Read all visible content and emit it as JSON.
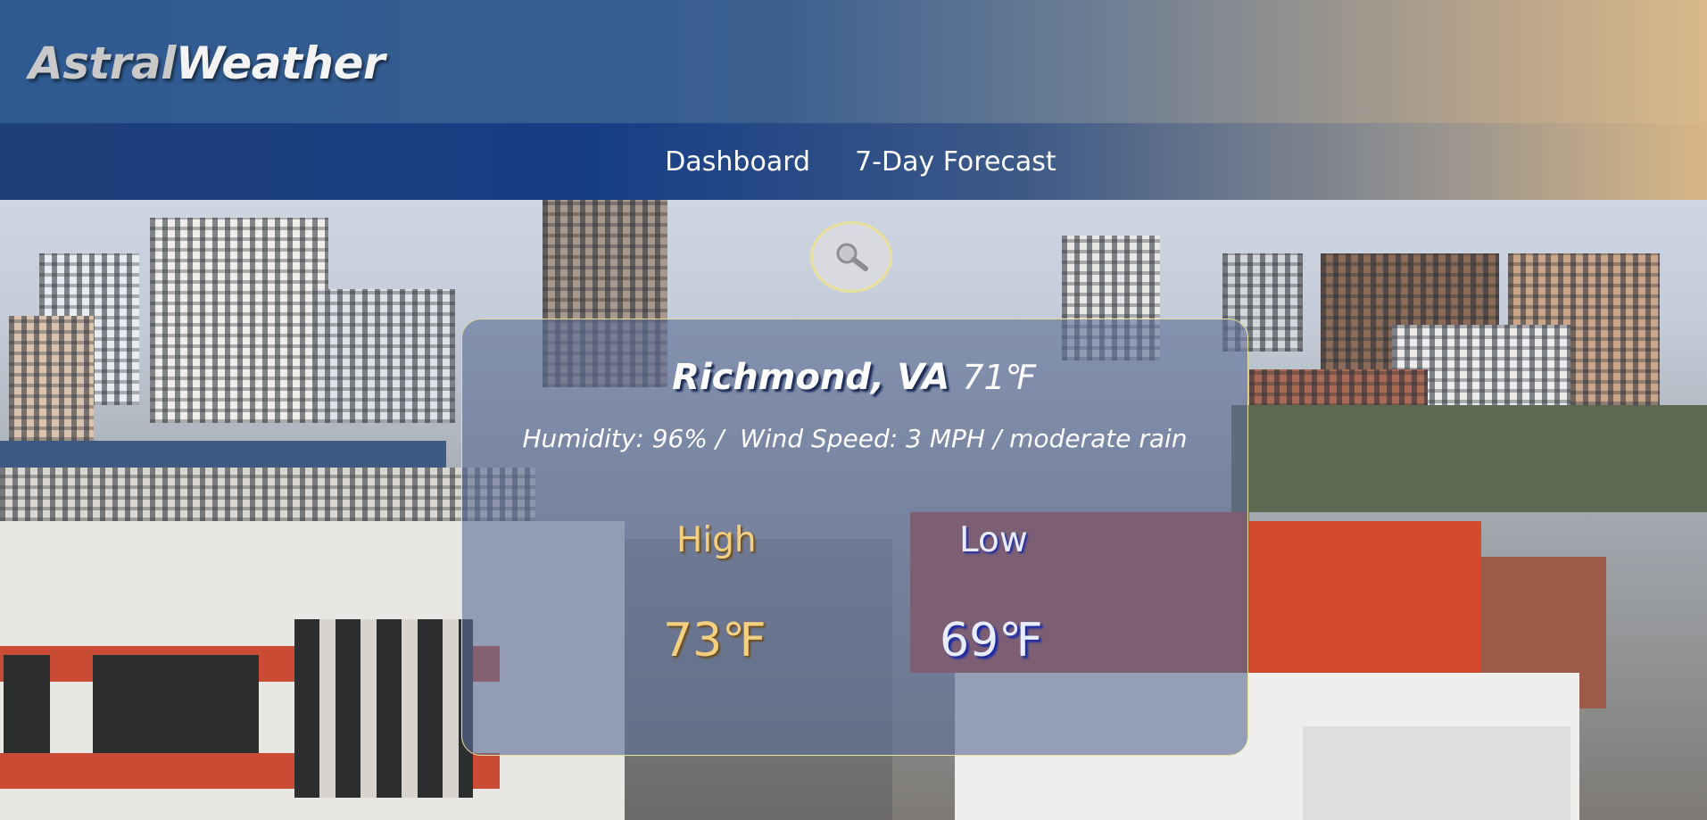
{
  "brand": {
    "part1": "Astral",
    "part2": "Weather"
  },
  "nav": {
    "items": [
      "Dashboard",
      "7-Day Forecast"
    ]
  },
  "search": {
    "icon": "search-icon"
  },
  "weather": {
    "city": "Richmond, VA",
    "current_temp": "71℉",
    "details": "Humidity: 96% /  Wind Speed: 3 MPH / moderate rain",
    "high_label": "High",
    "high_value": "73℉",
    "low_label": "Low",
    "low_value": "69℉"
  },
  "colors": {
    "header_start": "#2e5a92",
    "header_end": "#d9b98a",
    "card_border": "#e8de98",
    "high_color": "#f3cf7f",
    "low_color": "#e7ecff"
  }
}
